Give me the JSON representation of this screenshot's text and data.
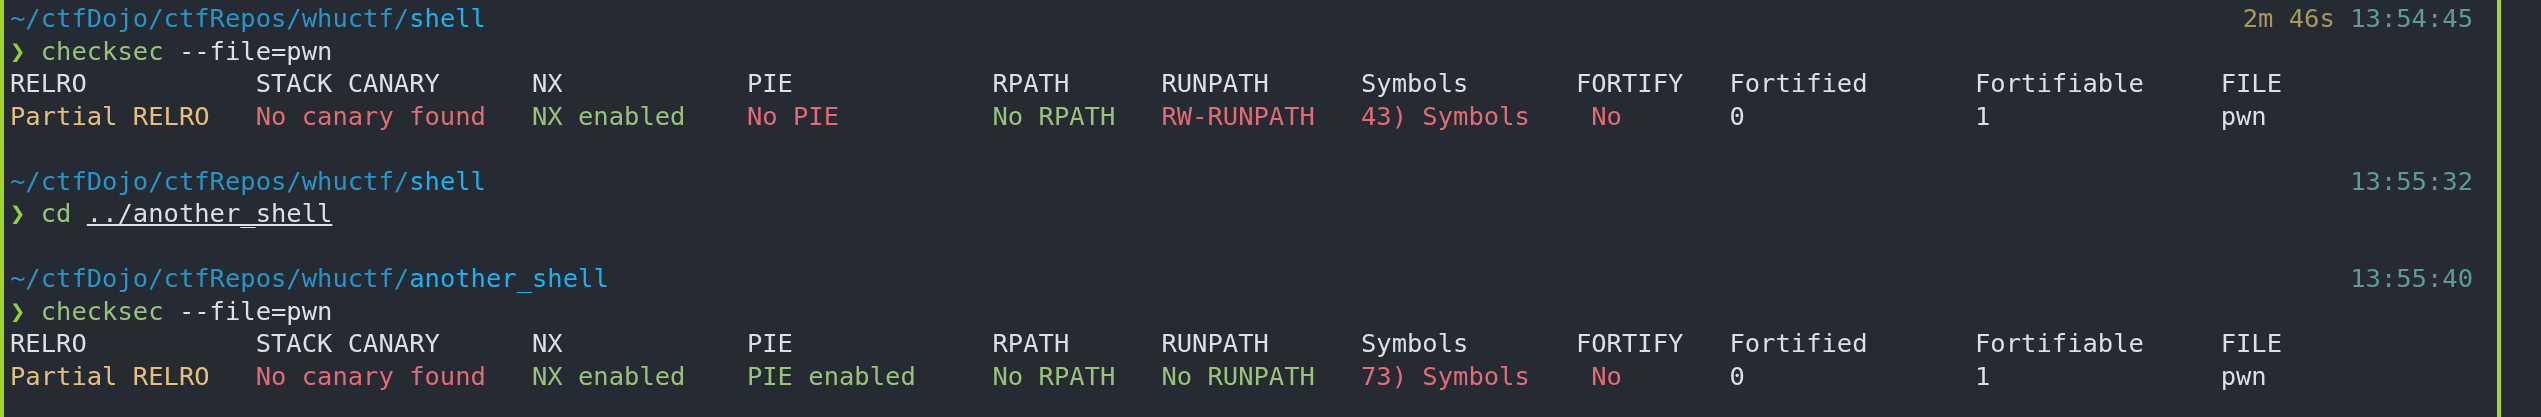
{
  "blocks": [
    {
      "path_dir": "~/ctfDojo/ctfRepos/whuctf/",
      "path_leaf": "shell",
      "duration": "2m 46s",
      "time": "13:54:45",
      "prompt": "❯",
      "command": "checksec",
      "args": "--file=pwn",
      "args_underlined": false,
      "output": {
        "headers": [
          "RELRO",
          "STACK CANARY",
          "NX",
          "PIE",
          "RPATH",
          "RUNPATH",
          "Symbols",
          "FORTIFY",
          "Fortified",
          "Fortifiable",
          "FILE"
        ],
        "values": [
          {
            "text": "Partial RELRO",
            "color": "#e5c07b"
          },
          {
            "text": "No canary found",
            "color": "#e06c75"
          },
          {
            "text": "NX enabled",
            "color": "#98c379"
          },
          {
            "text": "No PIE",
            "color": "#e06c75"
          },
          {
            "text": "No RPATH",
            "color": "#98c379"
          },
          {
            "text": "RW-RUNPATH",
            "color": "#e06c75"
          },
          {
            "text": "43) Symbols",
            "color": "#e06c75"
          },
          {
            "text": "No",
            "color": "#e06c75"
          },
          {
            "text": "0",
            "color": "#dcdfe4"
          },
          {
            "text": "1",
            "color": "#dcdfe4"
          },
          {
            "text": "pwn",
            "color": "#dcdfe4"
          }
        ]
      }
    },
    {
      "path_dir": "~/ctfDojo/ctfRepos/whuctf/",
      "path_leaf": "shell",
      "time": "13:55:32",
      "prompt": "❯",
      "command": "cd",
      "args": "../another_shell",
      "args_underlined": true
    },
    {
      "path_dir": "~/ctfDojo/ctfRepos/whuctf/",
      "path_leaf": "another_shell",
      "time": "13:55:40",
      "prompt": "❯",
      "command": "checksec",
      "args": "--file=pwn",
      "args_underlined": false,
      "output": {
        "headers": [
          "RELRO",
          "STACK CANARY",
          "NX",
          "PIE",
          "RPATH",
          "RUNPATH",
          "Symbols",
          "FORTIFY",
          "Fortified",
          "Fortifiable",
          "FILE"
        ],
        "values": [
          {
            "text": "Partial RELRO",
            "color": "#e5c07b"
          },
          {
            "text": "No canary found",
            "color": "#e06c75"
          },
          {
            "text": "NX enabled",
            "color": "#98c379"
          },
          {
            "text": "PIE enabled",
            "color": "#98c379"
          },
          {
            "text": "No RPATH",
            "color": "#98c379"
          },
          {
            "text": "No RUNPATH",
            "color": "#98c379"
          },
          {
            "text": "73) Symbols",
            "color": "#e06c75"
          },
          {
            "text": "No",
            "color": "#e06c75"
          },
          {
            "text": "0",
            "color": "#dcdfe4"
          },
          {
            "text": "1",
            "color": "#dcdfe4"
          },
          {
            "text": "pwn",
            "color": "#dcdfe4"
          }
        ]
      }
    }
  ]
}
